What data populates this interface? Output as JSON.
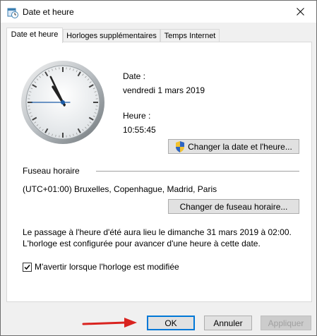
{
  "window": {
    "title": "Date et heure",
    "icon": "clock-calendar-icon",
    "close_icon": "close-icon"
  },
  "tabs": [
    {
      "label": "Date et heure",
      "active": true
    },
    {
      "label": "Horloges supplémentaires",
      "active": false
    },
    {
      "label": "Temps Internet",
      "active": false
    }
  ],
  "datetime": {
    "date_label": "Date :",
    "date_value": "vendredi 1 mars 2019",
    "time_label": "Heure :",
    "time_value": "10:55:45",
    "change_datetime_button": "Changer la date et l'heure...",
    "shield_icon": "uac-shield-icon"
  },
  "clock": {
    "hours": 10,
    "minutes": 55,
    "seconds": 45
  },
  "timezone": {
    "section_label": "Fuseau horaire",
    "value": "(UTC+01:00) Bruxelles, Copenhague, Madrid, Paris",
    "change_button": "Changer de fuseau horaire..."
  },
  "dst": {
    "line1": "Le passage à l'heure d'été aura lieu le dimanche 31 mars 2019 à 02:00.",
    "line2": "L'horloge est configurée pour avancer d'une heure à cette date."
  },
  "notify": {
    "label": "M'avertir lorsque l'horloge est modifiée",
    "checked": true
  },
  "footer": {
    "ok": "OK",
    "cancel": "Annuler",
    "apply": "Appliquer",
    "apply_disabled": true
  },
  "colors": {
    "accent": "#0078d7",
    "arrow": "#d9231f"
  }
}
